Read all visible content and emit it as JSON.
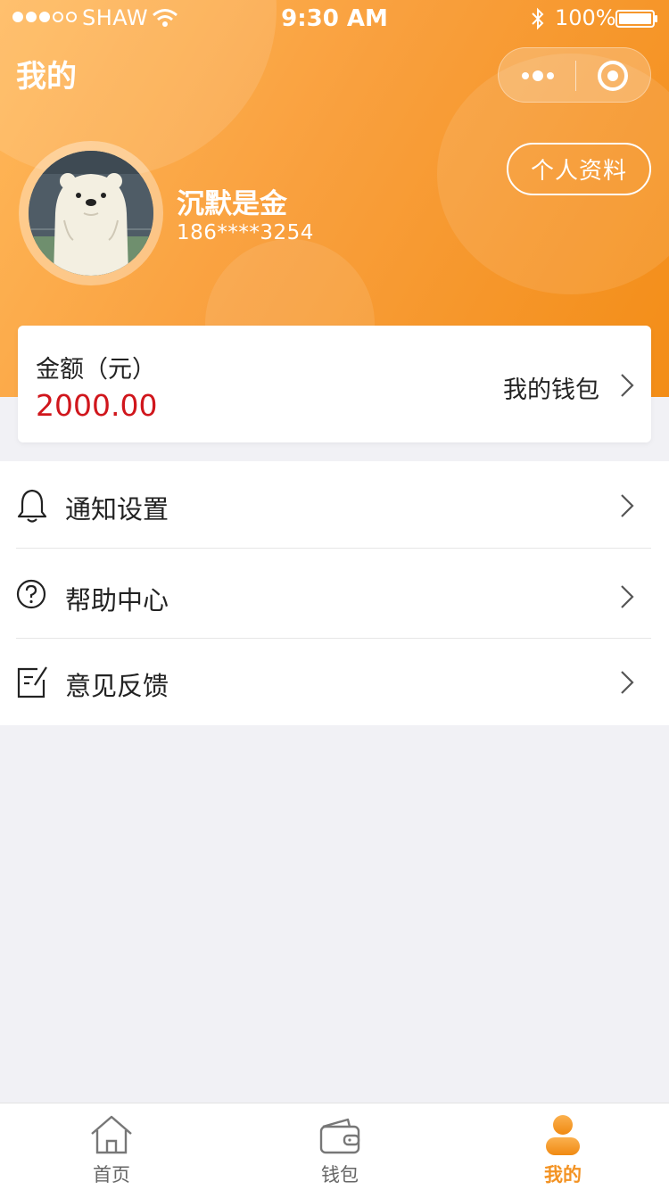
{
  "status_bar": {
    "carrier": "SHAW",
    "time": "9:30 AM",
    "battery": "100%"
  },
  "nav": {
    "title": "我的"
  },
  "profile": {
    "name": "沉默是金",
    "phone": "186****3254",
    "edit_button": "个人资料"
  },
  "balance": {
    "label": "金额（元）",
    "value": "2000.00",
    "wallet_link": "我的钱包"
  },
  "menu": [
    {
      "label": "通知设置",
      "icon": "bell-icon"
    },
    {
      "label": "帮助中心",
      "icon": "help-icon"
    },
    {
      "label": "意见反馈",
      "icon": "feedback-icon"
    }
  ],
  "tabbar": [
    {
      "label": "首页",
      "icon": "home-icon",
      "active": false
    },
    {
      "label": "钱包",
      "icon": "wallet-icon",
      "active": false
    },
    {
      "label": "我的",
      "icon": "user-icon",
      "active": true
    }
  ],
  "colors": {
    "accent": "#f39324",
    "header_start": "#ffb85a",
    "header_end": "#f38d17",
    "balance_value": "#d0161c",
    "background": "#f1f1f5"
  }
}
